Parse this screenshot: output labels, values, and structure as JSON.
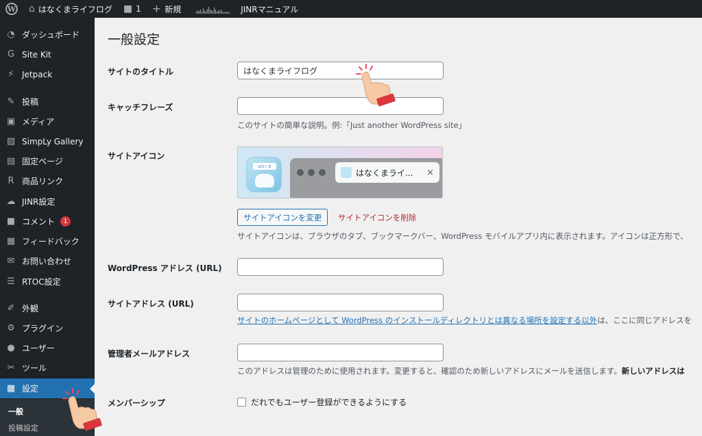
{
  "adminbar": {
    "site_name": "はなくまライフログ",
    "comments_count": "1",
    "new_label": "新規",
    "manual_label": "JINRマニュアル"
  },
  "sidebar": {
    "items": [
      {
        "label": "ダッシュボード",
        "icon": "dashboard-icon"
      },
      {
        "label": "Site Kit",
        "icon": "google-g-icon"
      },
      {
        "label": "Jetpack",
        "icon": "jetpack-icon"
      },
      {
        "label": "投稿",
        "icon": "pin-icon"
      },
      {
        "label": "メディア",
        "icon": "media-icon"
      },
      {
        "label": "SimpLy Gallery",
        "icon": "gallery-icon"
      },
      {
        "label": "固定ページ",
        "icon": "page-icon"
      },
      {
        "label": "商品リンク",
        "icon": "product-link-icon"
      },
      {
        "label": "JINR設定",
        "icon": "jinr-icon"
      },
      {
        "label": "コメント",
        "icon": "comment-icon",
        "badge": "1"
      },
      {
        "label": "フィードバック",
        "icon": "feedback-icon"
      },
      {
        "label": "お問い合わせ",
        "icon": "mail-icon"
      },
      {
        "label": "RTOC設定",
        "icon": "list-icon"
      },
      {
        "label": "外観",
        "icon": "appearance-icon"
      },
      {
        "label": "プラグイン",
        "icon": "plugin-icon"
      },
      {
        "label": "ユーザー",
        "icon": "user-icon"
      },
      {
        "label": "ツール",
        "icon": "tools-icon"
      },
      {
        "label": "設定",
        "icon": "settings-icon",
        "active": true
      }
    ],
    "submenu": [
      "一般",
      "投稿設定"
    ]
  },
  "page": {
    "title": "一般設定",
    "site_title_label": "サイトのタイトル",
    "site_title_value": "はなくまライフログ",
    "tagline_label": "キャッチフレーズ",
    "tagline_value": "",
    "tagline_desc": "このサイトの簡単な説明。例:「Just another WordPress site」",
    "site_icon_label": "サイトアイコン",
    "icon_tag_text": "はなくま",
    "tab_title": "はなくまライ...",
    "tab_close": "×",
    "change_icon_button": "サイトアイコンを変更",
    "remove_icon_link": "サイトアイコンを削除",
    "site_icon_desc": "サイトアイコンは、ブラウザのタブ、ブックマークバー、WordPress モバイルアプリ内に表示されます。アイコンは正方形で、",
    "wp_address_label": "WordPress アドレス (URL)",
    "wp_address_value": "",
    "site_address_label": "サイトアドレス (URL)",
    "site_address_value": "",
    "site_address_desc_link": "サイトのホームページとして WordPress のインストールディレクトリとは異なる場所を設定する以外",
    "site_address_desc_rest": "は、ここに同じアドレスを",
    "admin_email_label": "管理者メールアドレス",
    "admin_email_value": "",
    "admin_email_desc": "このアドレスは管理のために使用されます。変更すると、確認のため新しいアドレスにメールを送信します。",
    "admin_email_desc_bold": "新しいアドレスは",
    "membership_label": "メンバーシップ",
    "membership_checkbox": "だれでもユーザー登録ができるようにする"
  },
  "colors": {
    "adminbar": "#1d2327",
    "accent": "#2271b1",
    "danger": "#b32d2e",
    "background": "#f0f0f1"
  }
}
